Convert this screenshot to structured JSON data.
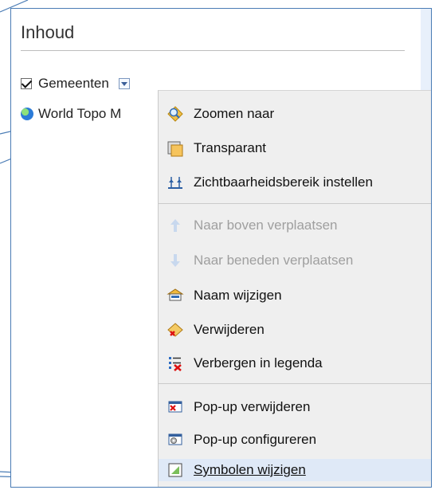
{
  "panel": {
    "title": "Inhoud",
    "layers": [
      {
        "label": "Gemeenten",
        "checked": true,
        "icon": "checkbox-checked"
      },
      {
        "label": "World Topo M",
        "icon": "globe-icon"
      }
    ]
  },
  "menu": {
    "items": [
      {
        "label": "Zoomen naar",
        "icon": "zoom-to-icon",
        "enabled": true
      },
      {
        "label": "Transparant",
        "icon": "transparency-icon",
        "enabled": true
      },
      {
        "label": "Zichtbaarheidsbereik instellen",
        "icon": "visibility-range-icon",
        "enabled": true
      },
      {
        "label": "Naar boven verplaatsen",
        "icon": "move-up-icon",
        "enabled": false
      },
      {
        "label": "Naar beneden verplaatsen",
        "icon": "move-down-icon",
        "enabled": false
      },
      {
        "label": "Naam wijzigen",
        "icon": "rename-icon",
        "enabled": true
      },
      {
        "label": "Verwijderen",
        "icon": "delete-icon",
        "enabled": true
      },
      {
        "label": "Verbergen in legenda",
        "icon": "hide-in-legend-icon",
        "enabled": true
      },
      {
        "label": "Pop-up verwijderen",
        "icon": "popup-remove-icon",
        "enabled": true
      },
      {
        "label": "Pop-up configureren",
        "icon": "popup-configure-icon",
        "enabled": true
      },
      {
        "label": "Symbolen wijzigen",
        "icon": "symbols-change-icon",
        "enabled": true,
        "active": true
      }
    ]
  },
  "colors": {
    "border_blue": "#4a7cb5",
    "menu_bg": "#efefef",
    "active_bg": "#dfe9f7",
    "disabled_text": "#9f9f9f"
  }
}
